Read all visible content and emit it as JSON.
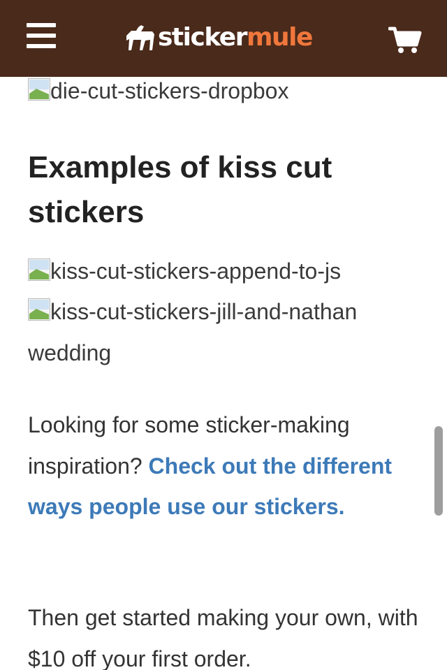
{
  "header": {
    "logo": {
      "word1": "sticker",
      "word2": "mule"
    },
    "menu_icon": "hamburger-menu-icon",
    "cart_icon": "shopping-cart-icon",
    "colors": {
      "background": "#4a2a1b",
      "logo_accent": "#f0773c"
    }
  },
  "images": {
    "die_cut_alt": "die-cut-stickers-dropbox",
    "kiss_cut_1_alt": "kiss-cut-stickers-append-to-js",
    "kiss_cut_2_alt": "kiss-cut-stickers-jill-and-nathan wedding"
  },
  "section_heading": "Examples of kiss cut stickers",
  "inspiration": {
    "text": "Looking for some sticker-making inspiration?",
    "link": "Check out the different ways people use our stickers."
  },
  "cta": {
    "text": "Then get started making your own, with $10 off your first order."
  },
  "colors": {
    "link": "#3d7ab8",
    "body_text": "#333333"
  }
}
